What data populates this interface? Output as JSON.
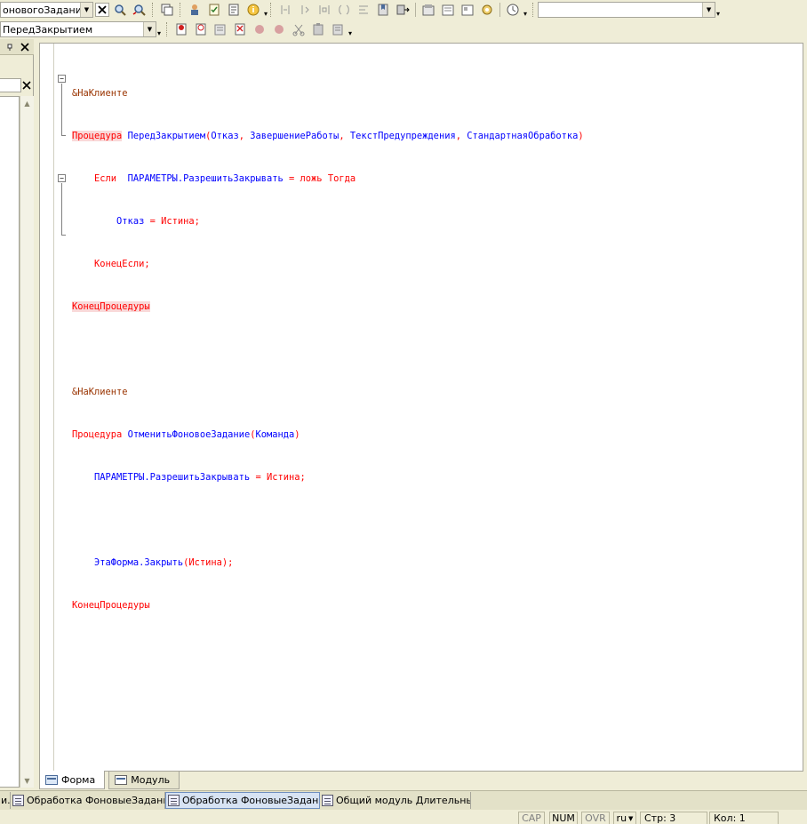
{
  "toolbar_top": {
    "combo_value": "оновогоЗадания",
    "search_value": ""
  },
  "toolbar_second": {
    "procedure_combo_value": "ПередЗакрытием"
  },
  "editor": {
    "lines": [
      "&НаКлиенте",
      "Процедура ПередЗакрытием(Отказ, ЗавершениеРаботы, ТекстПредупреждения, СтандартнаяОбработка)",
      "Если  ПАРАМЕТРЫ.РазрешитьЗакрывать = ложь Тогда",
      "Отказ = Истина;",
      "КонецЕсли;",
      "КонецПроцедуры",
      "",
      "&НаКлиенте",
      "Процедура ОтменитьФоновоеЗадание(Команда)",
      "ПАРАМЕТРЫ.РазрешитьЗакрывать = Истина;",
      "",
      "ЭтаФорма.Закрыть(Истина);",
      "КонецПроцедуры"
    ]
  },
  "tabs": [
    {
      "label": "Форма",
      "active": true
    },
    {
      "label": "Модуль",
      "active": false
    }
  ],
  "windows": [
    {
      "label": "и..."
    },
    {
      "label": "Обработка ФоновыеЗадани..."
    },
    {
      "label": "Обработка ФоновыеЗадани...",
      "active": true
    },
    {
      "label": "Общий модуль Длительные..."
    }
  ],
  "status": {
    "cap": "CAP",
    "num": "NUM",
    "ovr": "OVR",
    "lang": "ru",
    "line": "Стр: 3",
    "col": "Кол: 1"
  },
  "colors": {
    "keyword": "#ff0000",
    "identifier": "#0000ff",
    "preprocessor": "#993300",
    "highlight": "#f9d9d9",
    "background": "#efedd7"
  },
  "icons": [
    "find-icon",
    "find-next-icon",
    "copy-icon",
    "wizard-icon",
    "syntax-check-icon",
    "info-icon",
    "bookmark-icon",
    "indent-icon",
    "outdent-icon",
    "comment-icon",
    "breakpoint-icon",
    "clock-icon"
  ]
}
